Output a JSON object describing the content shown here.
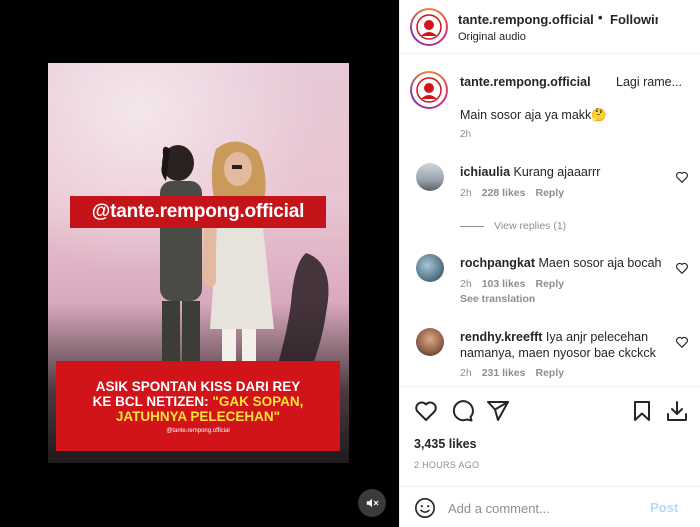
{
  "video": {
    "watermark": "@tante.rempong.official",
    "headline_line1": "ASIK SPONTAN KISS DARI REY",
    "headline_line2a": "KE BCL NETIZEN: ",
    "headline_line2b": "\"GAK SOPAN,",
    "headline_line3": "JATUHNYA PELECEHAN\"",
    "headline_credit": "@tante.rempong.official",
    "mute_icon": "speaker-muted-icon"
  },
  "header": {
    "username": "tante.rempong.official",
    "dot": "•",
    "follow_label": "Following",
    "audio": "Original audio"
  },
  "caption": {
    "username": "tante.rempong.official",
    "preview": "Lagi rame...",
    "text": "Main sosor aja ya makk🤔",
    "time": "2h"
  },
  "comments": [
    {
      "username": "ichiaulia",
      "text": "Kurang ajaaarrr",
      "time": "2h",
      "likes": "228 likes",
      "reply": "Reply",
      "view_replies": "View replies (1)"
    },
    {
      "username": "rochpangkat",
      "text": "Maen sosor aja bocah",
      "time": "2h",
      "likes": "103 likes",
      "reply": "Reply",
      "translation": "See translation"
    },
    {
      "username": "rendhy.kreefft",
      "text": "Iya anjr pelecehan namanya, maen nyosor bae ckckck",
      "time": "2h",
      "likes": "231 likes",
      "reply": "Reply"
    }
  ],
  "actions": {
    "likes": "3,435 likes",
    "timestamp": "2 HOURS AGO",
    "icons": [
      "heart-icon",
      "comment-icon",
      "share-icon",
      "bookmark-icon",
      "save-download-icon"
    ]
  },
  "add_comment": {
    "placeholder": "Add a comment...",
    "post_label": "Post"
  },
  "colors": {
    "accent_blue": "#0095f6",
    "post_disabled": "#b3dbff",
    "banner_red": "#c4141a",
    "headline_yellow": "#ffe234"
  }
}
